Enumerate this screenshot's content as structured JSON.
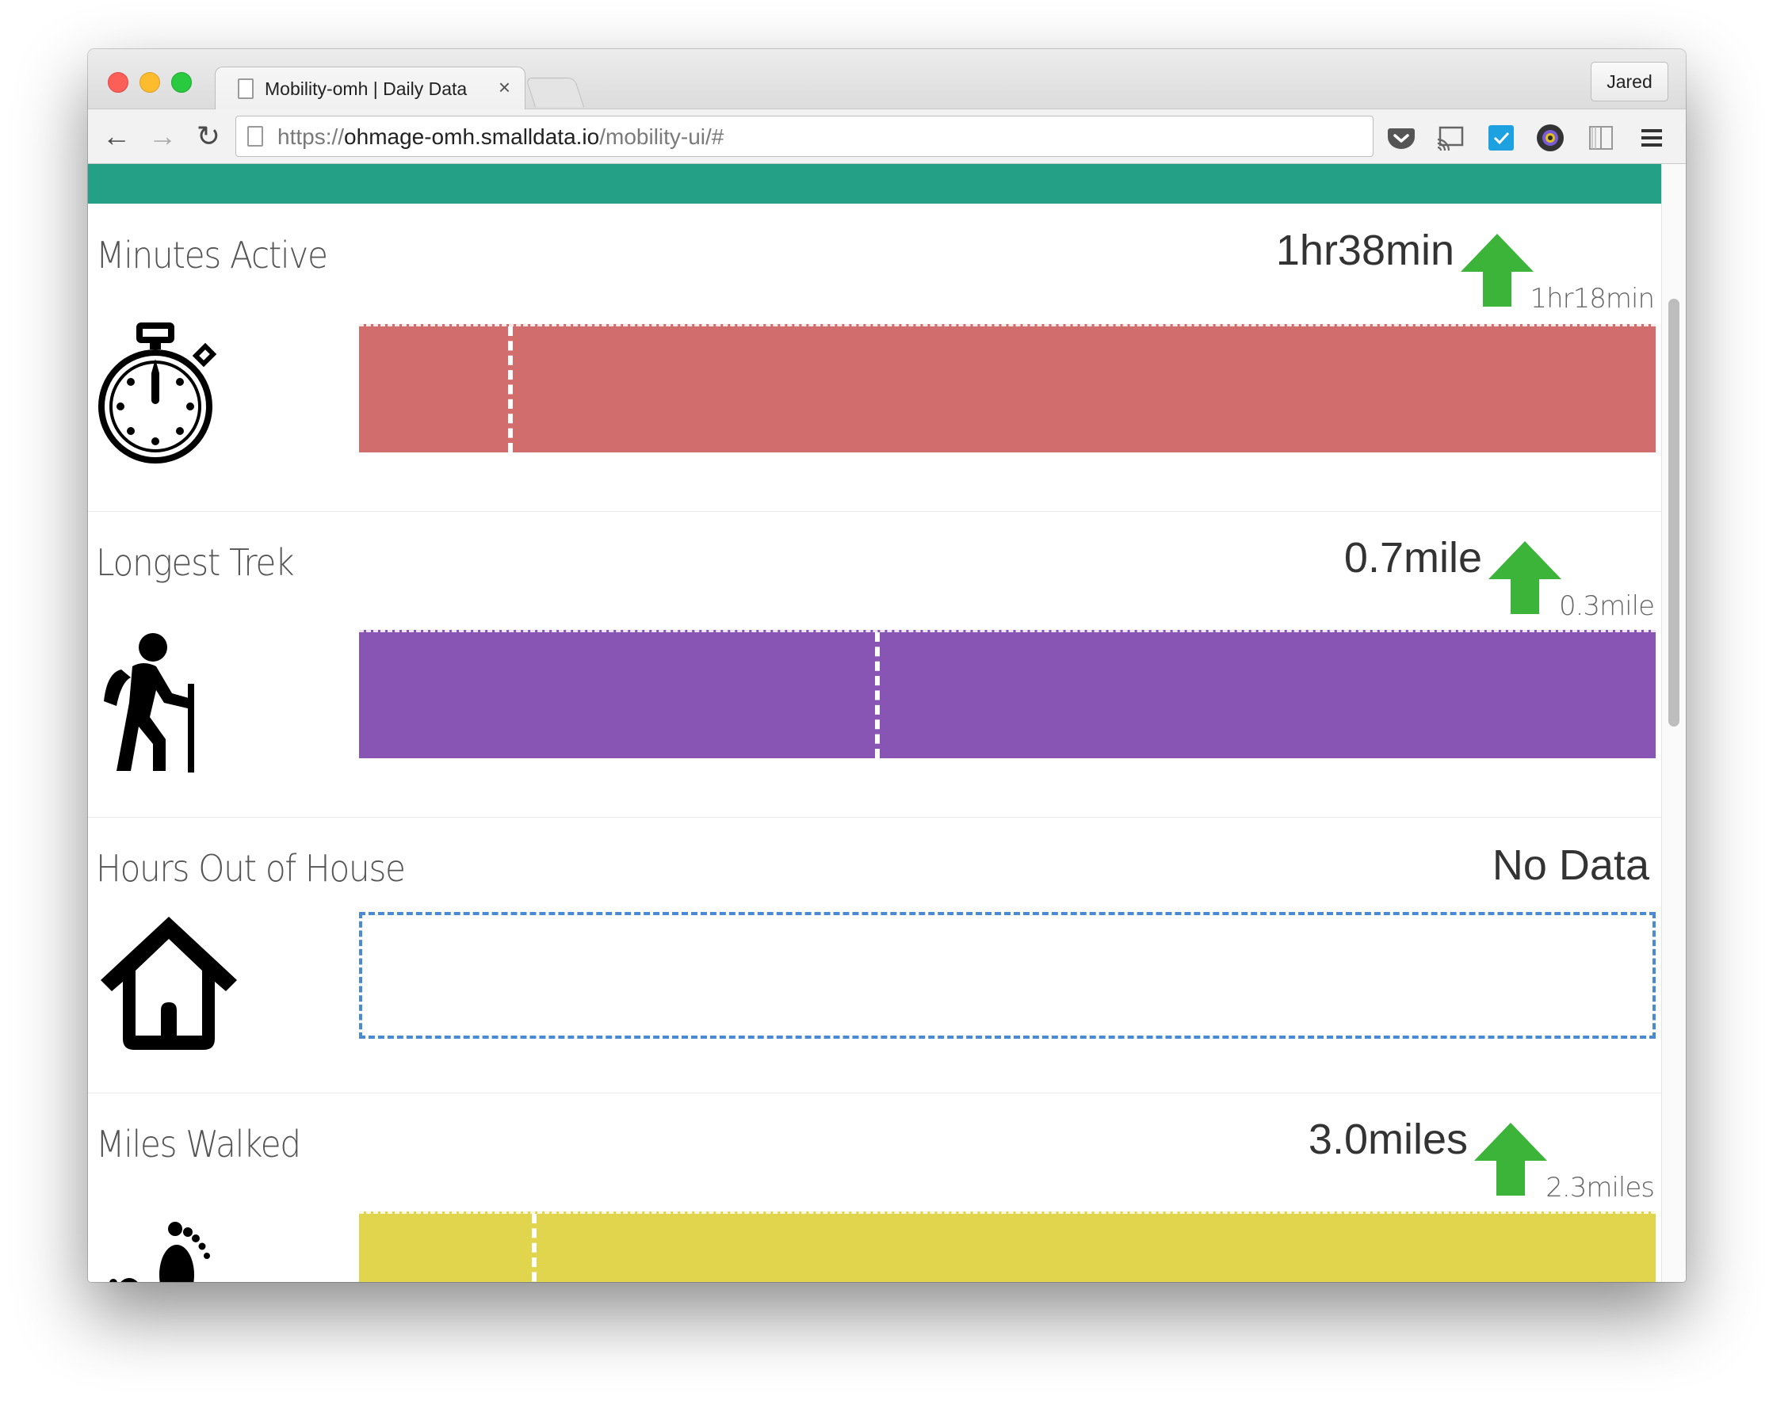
{
  "browser": {
    "tab_title": "Mobility-omh | Daily Data",
    "tab_close": "×",
    "profile_name": "Jared",
    "url_scheme": "https://",
    "url_host": "ohmage-omh.smalldata.io",
    "url_path": "/mobility-ui/#",
    "nav": {
      "back": "←",
      "forward": "→",
      "reload": "↻"
    }
  },
  "colors": {
    "header": "#23a086",
    "minutes_active": "#d26d6d",
    "longest_trek": "#8855b4",
    "hours_out": "#4a89d4",
    "miles_walked": "#e1d54e",
    "trend_up": "#3cb43a"
  },
  "metrics": [
    {
      "label": "Minutes Active",
      "icon": "stopwatch-icon",
      "value": "1hr38min",
      "previous": "1hr18min",
      "trend": "up",
      "marker_fraction": 0.115
    },
    {
      "label": "Longest Trek",
      "icon": "hiker-icon",
      "value": "0.7mile",
      "previous": "0.3mile",
      "trend": "up",
      "marker_fraction": 0.398
    },
    {
      "label": "Hours Out of House",
      "icon": "house-icon",
      "value": "No Data",
      "trend": "none"
    },
    {
      "label": "Miles Walked",
      "icon": "footprints-icon",
      "value": "3.0miles",
      "previous": "2.3miles",
      "trend": "up",
      "marker_fraction": 0.133
    }
  ]
}
